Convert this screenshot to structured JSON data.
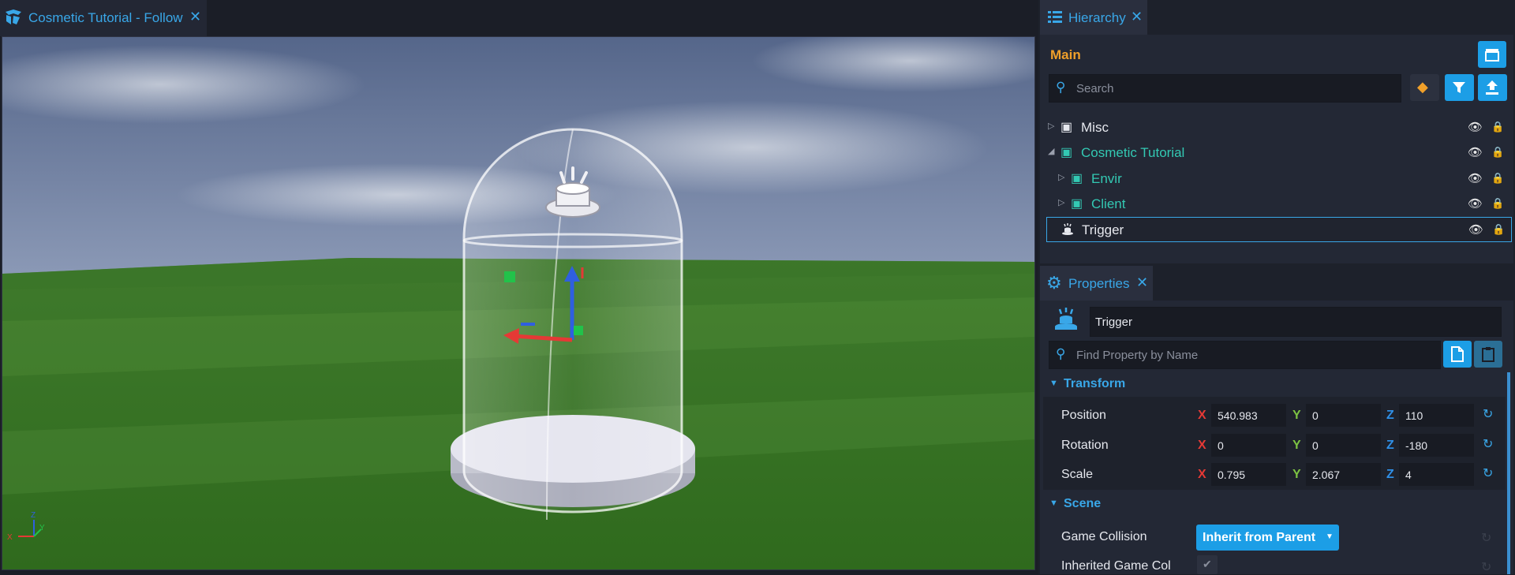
{
  "viewport": {
    "tab_title": "Cosmetic Tutorial - Follow",
    "gizmo_axes": {
      "z": "Z",
      "x": "X",
      "y": "Y"
    }
  },
  "hierarchy": {
    "tab_title": "Hierarchy",
    "root": "Main",
    "search_placeholder": "Search",
    "items": [
      {
        "label": "Misc",
        "color": "#e6e8ee"
      },
      {
        "label": "Cosmetic Tutorial",
        "color": "#33c9b3"
      },
      {
        "label": "Envir",
        "color": "#33c9b3"
      },
      {
        "label": "Client",
        "color": "#33c9b3"
      },
      {
        "label": "Trigger",
        "color": "#e6e8ee"
      }
    ]
  },
  "properties": {
    "tab_title": "Properties",
    "object_name": "Trigger",
    "search_placeholder": "Find Property by Name",
    "sections": {
      "transform": "Transform",
      "scene": "Scene"
    },
    "transform": {
      "position": {
        "label": "Position",
        "x": "540.983",
        "y": "0",
        "z": "110"
      },
      "rotation": {
        "label": "Rotation",
        "x": "0",
        "y": "0",
        "z": "-180"
      },
      "scale": {
        "label": "Scale",
        "x": "0.795",
        "y": "2.067",
        "z": "4"
      }
    },
    "axis_labels": {
      "x": "X",
      "y": "Y",
      "z": "Z"
    },
    "scene": {
      "game_collision_label": "Game Collision",
      "game_collision_value": "Inherit from Parent",
      "inherited_label": "Inherited Game Col"
    }
  },
  "colors": {
    "accent": "#1c9ee6",
    "root_orange": "#f0a02a",
    "axis_x": "#e53935",
    "axis_y": "#7cc242",
    "axis_z": "#2f8fe6"
  }
}
